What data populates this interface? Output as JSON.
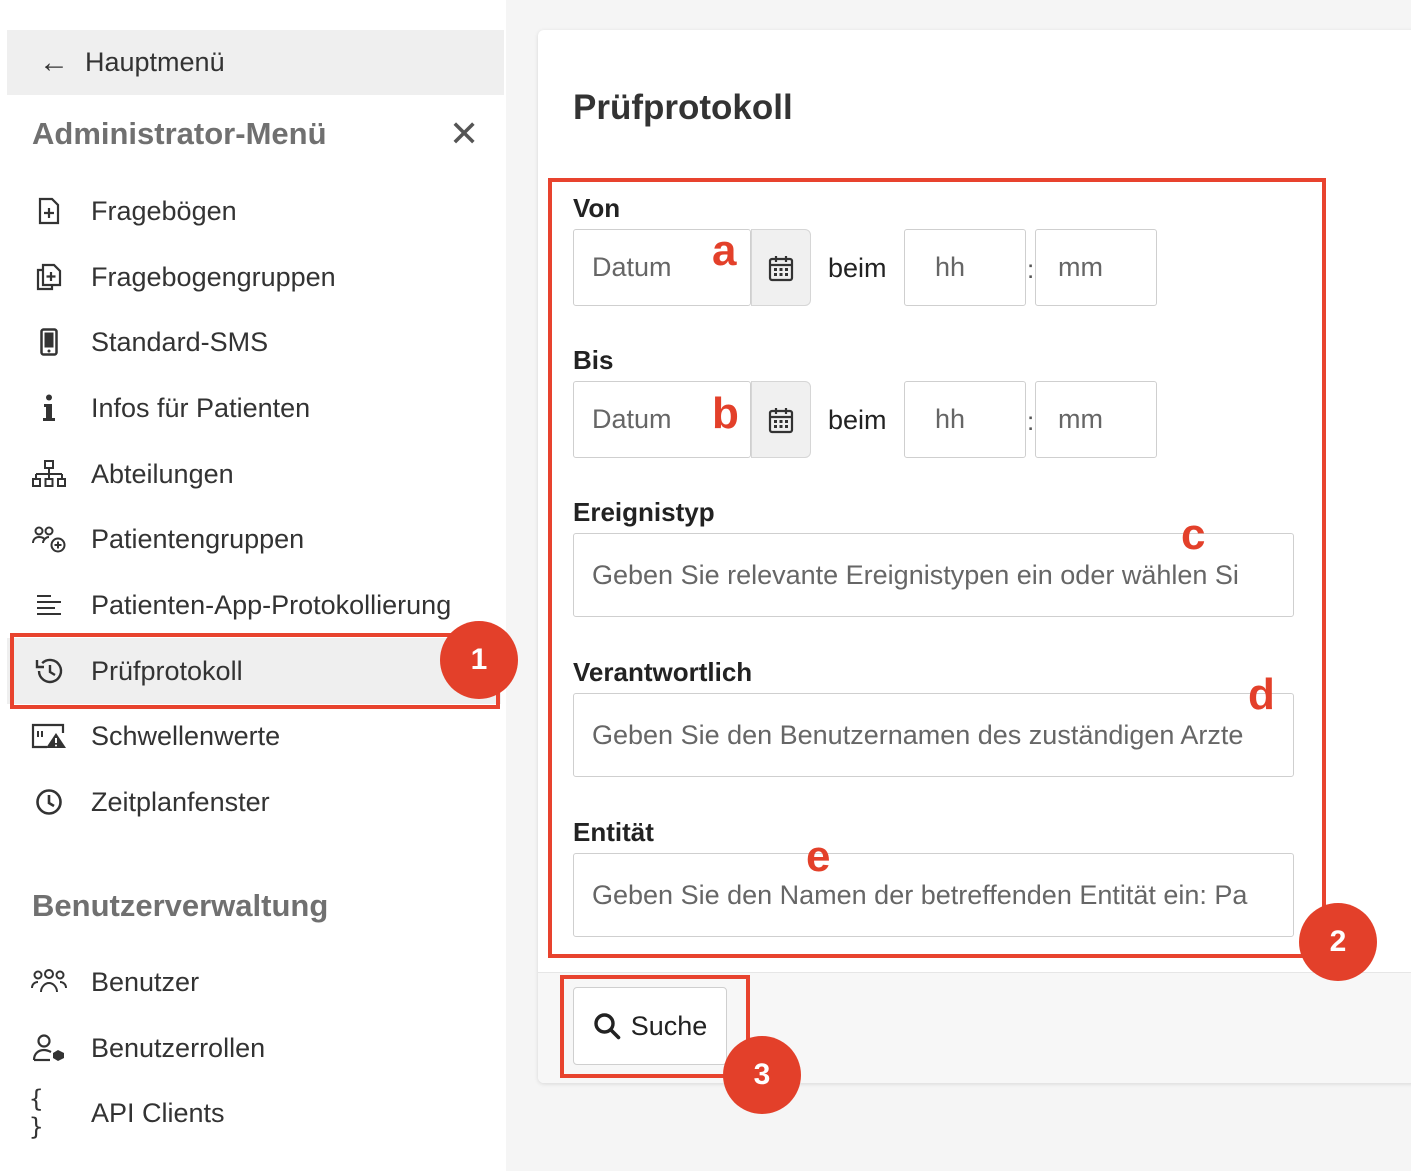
{
  "sidebar": {
    "back_label": "Hauptmenü",
    "admin_title": "Administrator-Menü",
    "close_symbol": "✕",
    "admin_items": [
      {
        "label": "Fragebögen",
        "icon": "file-plus-icon"
      },
      {
        "label": "Fragebogengruppen",
        "icon": "files-plus-icon"
      },
      {
        "label": "Standard-SMS",
        "icon": "mobile-icon"
      },
      {
        "label": "Infos für Patienten",
        "icon": "info-icon"
      },
      {
        "label": "Abteilungen",
        "icon": "sitemap-icon"
      },
      {
        "label": "Patientengruppen",
        "icon": "people-add-icon"
      },
      {
        "label": "Patienten-App-Protokollierung",
        "icon": "lines-icon"
      },
      {
        "label": "Prüfprotokoll",
        "icon": "history-icon",
        "active": true
      },
      {
        "label": "Schwellenwerte",
        "icon": "threshold-warning-icon"
      },
      {
        "label": "Zeitplanfenster",
        "icon": "clock-icon"
      }
    ],
    "user_title": "Benutzerverwaltung",
    "user_items": [
      {
        "label": "Benutzer",
        "icon": "users-icon"
      },
      {
        "label": "Benutzerrollen",
        "icon": "user-role-icon"
      },
      {
        "label": "API Clients",
        "icon": "braces-icon"
      }
    ],
    "braces_glyph": "{ }"
  },
  "main": {
    "title": "Prüfprotokoll",
    "von": {
      "label": "Von",
      "date_placeholder": "Datum",
      "beim": "beim",
      "hour_placeholder": "hh",
      "colon": ":",
      "minute_placeholder": "mm"
    },
    "bis": {
      "label": "Bis",
      "date_placeholder": "Datum",
      "beim": "beim",
      "hour_placeholder": "hh",
      "colon": ":",
      "minute_placeholder": "mm"
    },
    "ereignistyp": {
      "label": "Ereignistyp",
      "placeholder": "Geben Sie relevante Ereignistypen ein oder wählen Si"
    },
    "verantwortlich": {
      "label": "Verantwortlich",
      "placeholder": "Geben Sie den Benutzernamen des zuständigen Arzte"
    },
    "entitaet": {
      "label": "Entität",
      "placeholder": "Geben Sie den Namen der betreffenden Entität ein: Pa"
    },
    "search_label": "Suche"
  },
  "annotations": {
    "badges": [
      "1",
      "2",
      "3"
    ],
    "letters": [
      "a",
      "b",
      "c",
      "d",
      "e"
    ],
    "color": "#e3402a"
  }
}
